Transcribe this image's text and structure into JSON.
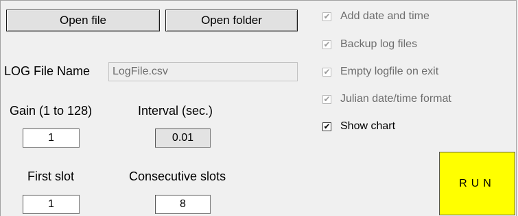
{
  "buttons": {
    "open_file": "Open file",
    "open_folder": "Open folder",
    "run": "RUN"
  },
  "log_file": {
    "label": "LOG File Name",
    "value": "LogFile.csv"
  },
  "gain": {
    "label": "Gain (1 to 128)",
    "value": "1"
  },
  "interval": {
    "label": "Interval (sec.)",
    "value": "0.01"
  },
  "first_slot": {
    "label": "First slot",
    "value": "1"
  },
  "consecutive_slots": {
    "label": "Consecutive slots",
    "value": "8"
  },
  "options": [
    {
      "label": "Add date and time",
      "checked": true,
      "enabled": false
    },
    {
      "label": "Backup log files",
      "checked": true,
      "enabled": false
    },
    {
      "label": "Empty logfile on exit",
      "checked": true,
      "enabled": false
    },
    {
      "label": "Julian date/time format",
      "checked": true,
      "enabled": false
    },
    {
      "label": "Show chart",
      "checked": true,
      "enabled": true
    }
  ],
  "colors": {
    "run_button_bg": "#ffff00",
    "window_bg": "#f0f0f0"
  }
}
